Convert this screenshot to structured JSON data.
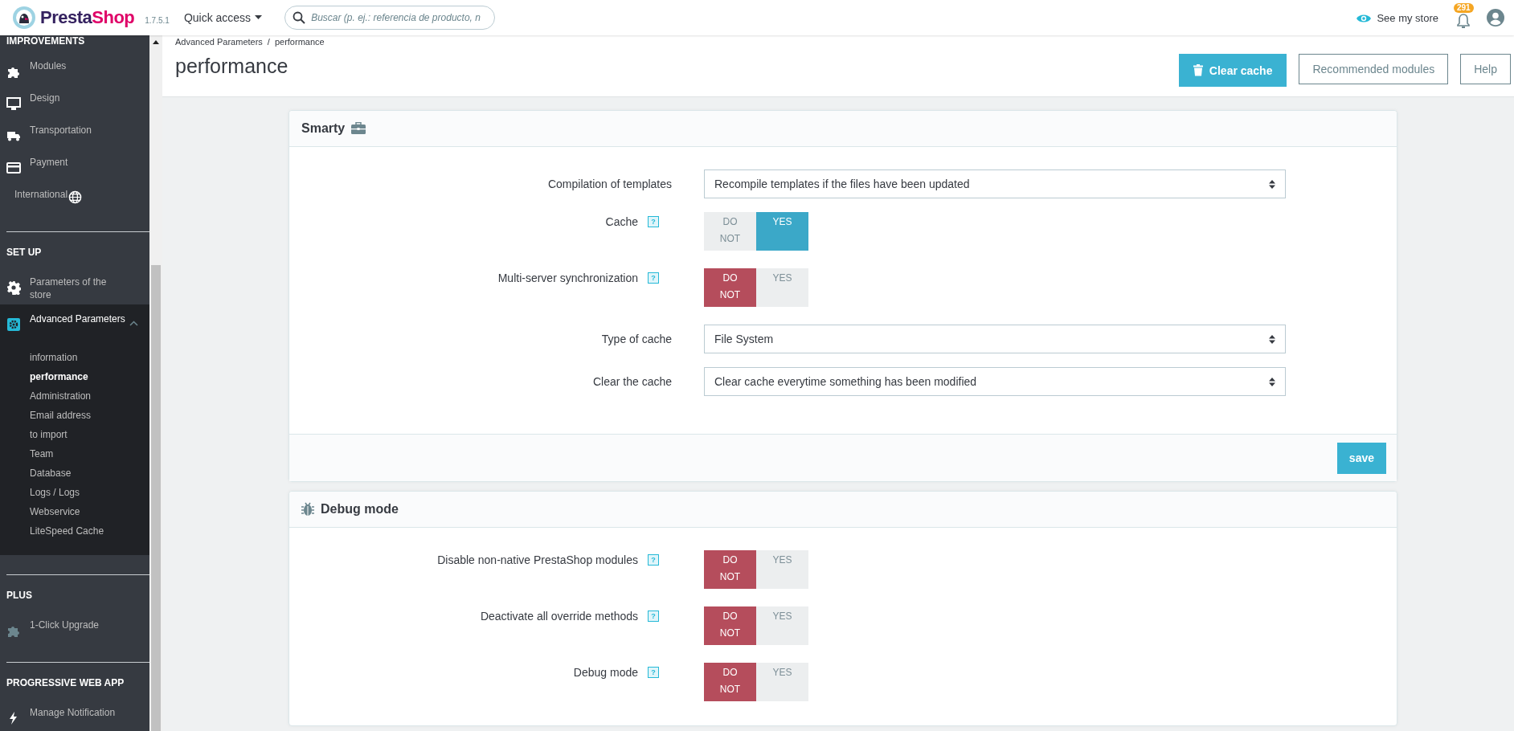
{
  "topbar": {
    "logo": [
      "Presta",
      "Shop"
    ],
    "version": "1.7.5.1",
    "quick_access": "Quick access",
    "search": {
      "placeholder": "Buscar (p. ej.: referencia de producto, n"
    },
    "see_my_store": "See my store",
    "notifications": "291"
  },
  "sidebar": {
    "sections": [
      {
        "title": "IMPROVEMENTS",
        "items": [
          {
            "label": "Modules",
            "selected": false,
            "expanded": false
          },
          {
            "label": "Design",
            "selected": false,
            "expanded": false
          },
          {
            "label": "Transportation",
            "selected": false,
            "expanded": false
          },
          {
            "label": "Payment",
            "selected": false,
            "expanded": false
          },
          {
            "label": "International",
            "selected": false,
            "expanded": false
          }
        ]
      },
      {
        "title": "SET UP",
        "items": [
          {
            "label": "Parameters of the store",
            "selected": false,
            "expanded": false
          },
          {
            "label": "Advanced Parameters",
            "selected": true,
            "expanded": true,
            "children": [
              {
                "label": "information",
                "selected": false
              },
              {
                "label": "performance",
                "selected": true
              },
              {
                "label": "Administration",
                "selected": false
              },
              {
                "label": "Email address",
                "selected": false
              },
              {
                "label": "to import",
                "selected": false
              },
              {
                "label": "Team",
                "selected": false
              },
              {
                "label": "Database",
                "selected": false
              },
              {
                "label": "Logs / Logs",
                "selected": false
              },
              {
                "label": "Webservice",
                "selected": false
              },
              {
                "label": "LiteSpeed Cache",
                "selected": false
              }
            ]
          }
        ]
      },
      {
        "title": "PLUS",
        "items": [
          {
            "label": "1-Click Upgrade",
            "selected": false,
            "expanded": false
          }
        ]
      },
      {
        "title": "PROGRESSIVE WEB APP",
        "items": [
          {
            "label": "Manage Notification",
            "selected": false,
            "expanded": false
          }
        ]
      }
    ]
  },
  "header": {
    "breadcrumb": {
      "items": [
        "Advanced Parameters",
        "performance"
      ],
      "separator": "/"
    },
    "title": "performance",
    "buttons": [
      {
        "label": "Clear cache",
        "kind": "primary"
      },
      {
        "label": "Recommended modules",
        "kind": "outline"
      },
      {
        "label": "Help",
        "kind": "outline"
      }
    ]
  },
  "panels": [
    {
      "title": "Smarty",
      "rows": [
        {
          "kind": "select",
          "label": "Compilation of templates",
          "value": "Recompile templates if the files have been updated"
        },
        {
          "kind": "switch",
          "label": "Cache",
          "help": "?",
          "options": [
            {
              "label": "DO NOT",
              "selected": false
            },
            {
              "label": "YES",
              "selected": true
            }
          ]
        },
        {
          "kind": "switch",
          "label": "Multi-server synchronization",
          "help": "?",
          "options": [
            {
              "label": "DO NOT",
              "selected": true
            },
            {
              "label": "YES",
              "selected": false
            }
          ]
        },
        {
          "kind": "select",
          "label": "Type of cache",
          "value": "File System"
        },
        {
          "kind": "select",
          "label": "Clear the cache",
          "value": "Clear cache everytime something has been modified"
        }
      ],
      "save": "save"
    },
    {
      "title": "Debug mode",
      "rows": [
        {
          "kind": "switch",
          "label": "Disable non-native PrestaShop modules",
          "help": "?",
          "options": [
            {
              "label": "DO NOT",
              "selected": true
            },
            {
              "label": "YES",
              "selected": false
            }
          ]
        },
        {
          "kind": "switch",
          "label": "Deactivate all override methods",
          "help": "?",
          "options": [
            {
              "label": "DO NOT",
              "selected": true
            },
            {
              "label": "YES",
              "selected": false
            }
          ]
        },
        {
          "kind": "switch",
          "label": "Debug mode",
          "help": "?",
          "options": [
            {
              "label": "DO NOT",
              "selected": true
            },
            {
              "label": "YES",
              "selected": false
            }
          ]
        }
      ]
    }
  ]
}
